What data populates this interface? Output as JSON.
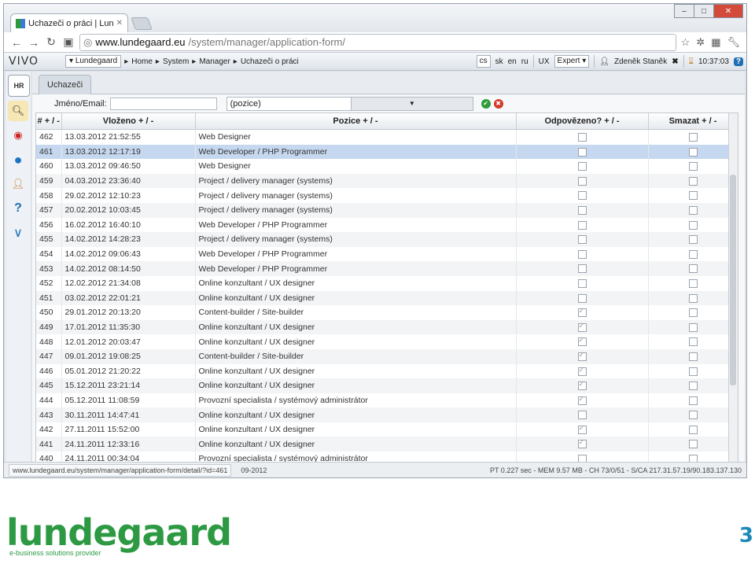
{
  "browser": {
    "tab_title": "Uchazeči o práci | Lundegaar",
    "url_domain": "www.lundegaard.eu",
    "url_path": "/system/manager/application-form/"
  },
  "app": {
    "logo": "VIVO",
    "breadcrumb": [
      "Lundegaard",
      "Home",
      "System",
      "Manager",
      "Uchazeči o práci"
    ],
    "lang_current": "cs",
    "langs": [
      "sk",
      "en",
      "ru"
    ],
    "ux_label": "UX",
    "ux_value": "Expert",
    "user": "Zdeněk Staněk",
    "time": "10:37:03"
  },
  "sidebar": {
    "items": [
      "HR",
      "search",
      "spiral",
      "globe",
      "user",
      "help",
      "chevron-down"
    ]
  },
  "main": {
    "tab": "Uchazeči",
    "filter_label": "Jméno/Email:",
    "filter_value": "",
    "position_select": "(pozice)"
  },
  "table": {
    "columns": [
      "# + / -",
      "Vloženo + / -",
      "Pozice + / -",
      "Odpovězeno? + / -",
      "Smazat + / -"
    ],
    "rows": [
      {
        "id": "462",
        "date": "13.03.2012 21:52:55",
        "pos": "Web Designer",
        "ans": false,
        "del": false
      },
      {
        "id": "461",
        "date": "13.03.2012 12:17:19",
        "pos": "Web Developer / PHP Programmer",
        "ans": false,
        "del": false
      },
      {
        "id": "460",
        "date": "13.03.2012 09:46:50",
        "pos": "Web Designer",
        "ans": false,
        "del": false
      },
      {
        "id": "459",
        "date": "04.03.2012 23:36:40",
        "pos": "Project / delivery manager (systems)",
        "ans": false,
        "del": false
      },
      {
        "id": "458",
        "date": "29.02.2012 12:10:23",
        "pos": "Project / delivery manager (systems)",
        "ans": false,
        "del": false
      },
      {
        "id": "457",
        "date": "20.02.2012 10:03:45",
        "pos": "Project / delivery manager (systems)",
        "ans": false,
        "del": false
      },
      {
        "id": "456",
        "date": "16.02.2012 16:40:10",
        "pos": "Web Developer / PHP Programmer",
        "ans": false,
        "del": false
      },
      {
        "id": "455",
        "date": "14.02.2012 14:28:23",
        "pos": "Project / delivery manager (systems)",
        "ans": false,
        "del": false
      },
      {
        "id": "454",
        "date": "14.02.2012 09:06:43",
        "pos": "Web Developer / PHP Programmer",
        "ans": false,
        "del": false
      },
      {
        "id": "453",
        "date": "14.02.2012 08:14:50",
        "pos": "Web Developer / PHP Programmer",
        "ans": false,
        "del": false
      },
      {
        "id": "452",
        "date": "12.02.2012 21:34:08",
        "pos": "Online konzultant / UX designer",
        "ans": false,
        "del": false
      },
      {
        "id": "451",
        "date": "03.02.2012 22:01:21",
        "pos": "Online konzultant / UX designer",
        "ans": false,
        "del": false
      },
      {
        "id": "450",
        "date": "29.01.2012 20:13:20",
        "pos": "Content-builder / Site-builder",
        "ans": true,
        "del": false
      },
      {
        "id": "449",
        "date": "17.01.2012 11:35:30",
        "pos": "Online konzultant / UX designer",
        "ans": true,
        "del": false
      },
      {
        "id": "448",
        "date": "12.01.2012 20:03:47",
        "pos": "Online konzultant / UX designer",
        "ans": true,
        "del": false
      },
      {
        "id": "447",
        "date": "09.01.2012 19:08:25",
        "pos": "Content-builder / Site-builder",
        "ans": true,
        "del": false
      },
      {
        "id": "446",
        "date": "05.01.2012 21:20:22",
        "pos": "Online konzultant / UX designer",
        "ans": true,
        "del": false
      },
      {
        "id": "445",
        "date": "15.12.2011 23:21:14",
        "pos": "Online konzultant / UX designer",
        "ans": true,
        "del": false
      },
      {
        "id": "444",
        "date": "05.12.2011 11:08:59",
        "pos": "Provozní specialista / systémový administrátor",
        "ans": true,
        "del": false
      },
      {
        "id": "443",
        "date": "30.11.2011 14:47:41",
        "pos": "Online konzultant / UX designer",
        "ans": false,
        "del": false
      },
      {
        "id": "442",
        "date": "27.11.2011 15:52:00",
        "pos": "Online konzultant / UX designer",
        "ans": true,
        "del": false
      },
      {
        "id": "441",
        "date": "24.11.2011 12:33:16",
        "pos": "Online konzultant / UX designer",
        "ans": true,
        "del": false
      },
      {
        "id": "440",
        "date": "24.11.2011 00:34:04",
        "pos": "Provozní specialista / systémový administrátor",
        "ans": false,
        "del": false
      }
    ],
    "selected_id": "461"
  },
  "status": {
    "link": "www.lundegaard.eu/system/manager/application-form/detail/?id=461",
    "left_tail": "09-2012",
    "right": "PT 0.227 sec - MEM 9.57 MB - CH 73/0/51 - S/CA 217.31.57.19/90.183.137.130"
  },
  "footer": {
    "brand": "lundegaard",
    "tagline": "e-business solutions provider",
    "page_number": "3"
  },
  "colors": {
    "brand_green": "#2d9a43",
    "page_number_blue": "#1c8ab8",
    "selected_row": "#c6d8ef"
  }
}
